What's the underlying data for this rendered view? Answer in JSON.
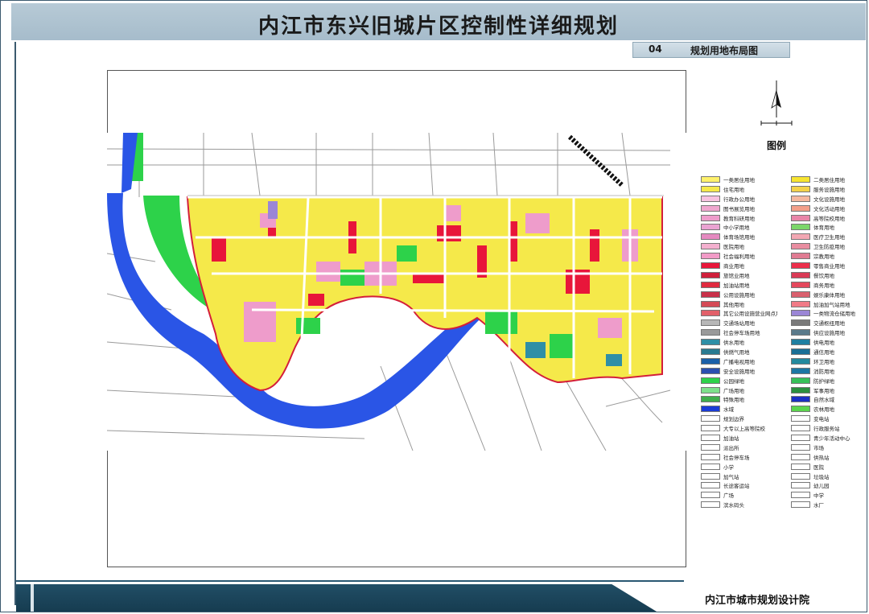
{
  "header": {
    "title": "内江市东兴旧城片区控制性详细规划"
  },
  "sheet": {
    "number": "04",
    "name": "规划用地布局图"
  },
  "legend": {
    "title": "图例",
    "col1": [
      {
        "label": "一类居住用地",
        "color": "#fff16b"
      },
      {
        "label": "住宅用地",
        "color": "#f5e94a"
      },
      {
        "label": "行政办公用地",
        "color": "#f7c2e0"
      },
      {
        "label": "图书展览用地",
        "color": "#f0a6cf"
      },
      {
        "label": "教育科研用地",
        "color": "#ee9ccb"
      },
      {
        "label": "中小学用地",
        "color": "#eaa3d2"
      },
      {
        "label": "体育场馆用地",
        "color": "#e58ac0"
      },
      {
        "label": "医院用地",
        "color": "#f4b0cf"
      },
      {
        "label": "社会福利用地",
        "color": "#f29bc7"
      },
      {
        "label": "商业用地",
        "color": "#e8163a"
      },
      {
        "label": "旅馆业用地",
        "color": "#cf1f3b"
      },
      {
        "label": "加油站用地",
        "color": "#e02a3f"
      },
      {
        "label": "公用设施用地",
        "color": "#c8314a"
      },
      {
        "label": "其他用地",
        "color": "#d44b57"
      },
      {
        "label": "其它公用设施营业网点用地",
        "color": "#e2606a"
      },
      {
        "label": "交通场站用地",
        "color": "#b7b7b7"
      },
      {
        "label": "社会停车场用地",
        "color": "#9a9a9a"
      },
      {
        "label": "供水用地",
        "color": "#2f8fa6"
      },
      {
        "label": "供燃气用地",
        "color": "#2a7b91"
      },
      {
        "label": "广播电视用地",
        "color": "#1a5fa8"
      },
      {
        "label": "安全设施用地",
        "color": "#2b4fb0"
      },
      {
        "label": "公园绿地",
        "color": "#2dd24a"
      },
      {
        "label": "广场用地",
        "color": "#7ee08c"
      },
      {
        "label": "特殊用地",
        "color": "#3fae4c"
      },
      {
        "label": "水域",
        "color": "#1a3cd6"
      },
      {
        "label": "规划边界",
        "color": "#ffffff"
      },
      {
        "label": "大专以上高等院校",
        "color": "#ffffff"
      },
      {
        "label": "加油站",
        "color": "#ffffff"
      },
      {
        "label": "派出所",
        "color": "#ffffff"
      },
      {
        "label": "社会停车场",
        "color": "#ffffff"
      },
      {
        "label": "小学",
        "color": "#ffffff"
      },
      {
        "label": "加气站",
        "color": "#ffffff"
      },
      {
        "label": "长途客运站",
        "color": "#ffffff"
      },
      {
        "label": "广场",
        "color": "#ffffff"
      },
      {
        "label": "滨水码头",
        "color": "#ffffff"
      }
    ],
    "col2": [
      {
        "label": "二类居住用地",
        "color": "#f7e430"
      },
      {
        "label": "服务设施用地",
        "color": "#f3d24a"
      },
      {
        "label": "文化设施用地",
        "color": "#f5b89f"
      },
      {
        "label": "文化活动用地",
        "color": "#f39f8a"
      },
      {
        "label": "高等院校用地",
        "color": "#e885a8"
      },
      {
        "label": "体育用地",
        "color": "#7bd66a"
      },
      {
        "label": "医疗卫生用地",
        "color": "#f2a7b3"
      },
      {
        "label": "卫生防疫用地",
        "color": "#e98da0"
      },
      {
        "label": "宗教用地",
        "color": "#e07b92"
      },
      {
        "label": "零售商业用地",
        "color": "#ec2f4c"
      },
      {
        "label": "餐饮用地",
        "color": "#d93a55"
      },
      {
        "label": "商务用地",
        "color": "#e4485c"
      },
      {
        "label": "娱乐康体用地",
        "color": "#d9606e"
      },
      {
        "label": "加油加气站用地",
        "color": "#f07a86"
      },
      {
        "label": "一类物流仓储用地",
        "color": "#9b86d6"
      },
      {
        "label": "交通枢纽用地",
        "color": "#7a7a7a"
      },
      {
        "label": "供应设施用地",
        "color": "#5b7a8a"
      },
      {
        "label": "供电用地",
        "color": "#1f7fa1"
      },
      {
        "label": "通信用地",
        "color": "#1a6f96"
      },
      {
        "label": "环卫用地",
        "color": "#23899e"
      },
      {
        "label": "消防用地",
        "color": "#1c76a3"
      },
      {
        "label": "防护绿地",
        "color": "#37c159"
      },
      {
        "label": "军事用地",
        "color": "#2a8f3e"
      },
      {
        "label": "自然水域",
        "color": "#1b2fc4"
      },
      {
        "label": "农林用地",
        "color": "#5bd44e"
      },
      {
        "label": "变电站",
        "color": "#ffffff"
      },
      {
        "label": "行政服务站",
        "color": "#ffffff"
      },
      {
        "label": "青少年活动中心",
        "color": "#ffffff"
      },
      {
        "label": "市场",
        "color": "#ffffff"
      },
      {
        "label": "供热站",
        "color": "#ffffff"
      },
      {
        "label": "医院",
        "color": "#ffffff"
      },
      {
        "label": "垃圾站",
        "color": "#ffffff"
      },
      {
        "label": "幼儿园",
        "color": "#ffffff"
      },
      {
        "label": "中学",
        "color": "#ffffff"
      },
      {
        "label": "水厂",
        "color": "#ffffff"
      }
    ]
  },
  "footer": {
    "organization": "内江市城市规划设计院"
  },
  "colors": {
    "header_band": "#b1c5d2",
    "footer_band": "#1d475d",
    "river": "#2a55e6",
    "residential": "#f5e94a",
    "commercial": "#e8163a",
    "education": "#ee9ccb",
    "green": "#2dd24a",
    "road": "#ffffff"
  }
}
